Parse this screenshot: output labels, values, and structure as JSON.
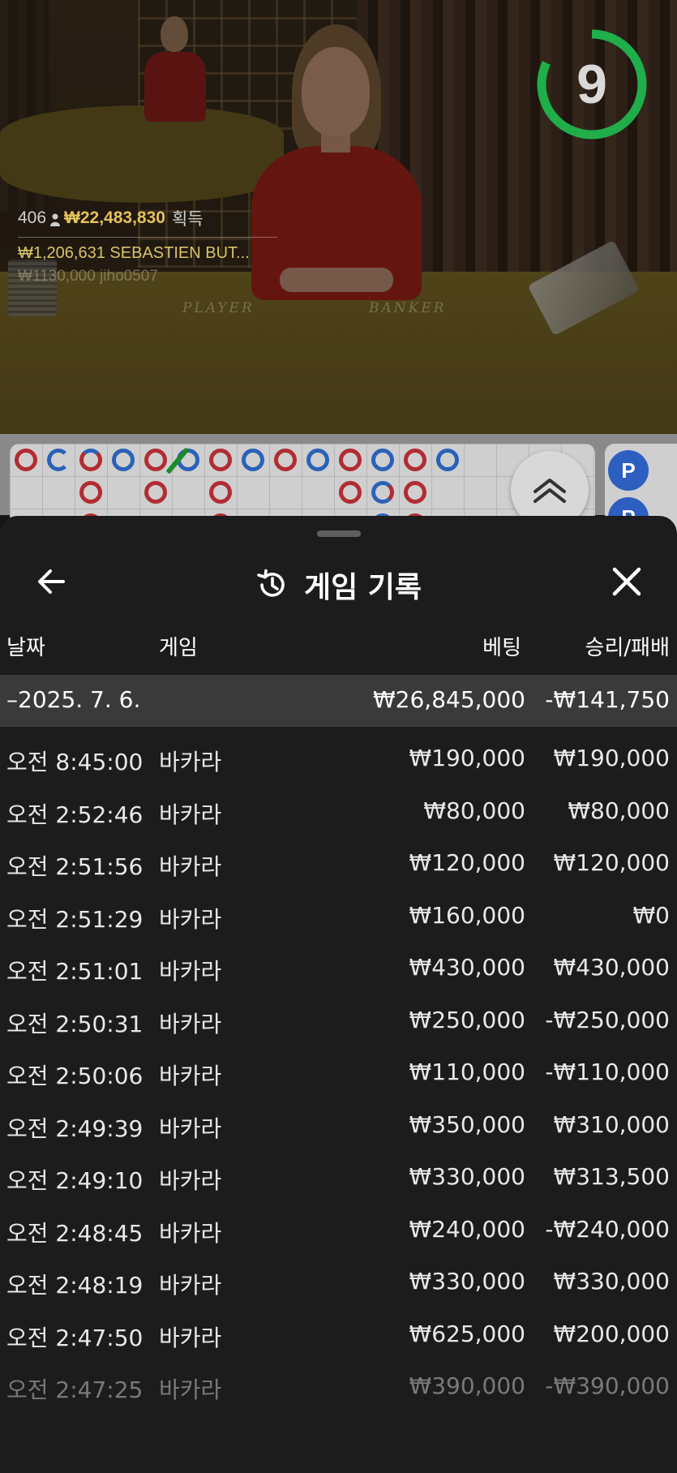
{
  "countdown": {
    "value": "9",
    "progress": 0.82,
    "color": "#1fae4a"
  },
  "winners": {
    "count": "406",
    "total": "₩22,483,830",
    "total_suffix": "획득",
    "top": [
      {
        "amount": "₩1,206,631",
        "name": "SEBASTIEN BUT..."
      },
      {
        "amount": "₩1130,000",
        "name": "jiho0507"
      }
    ]
  },
  "table_labels": {
    "player": "PLAYER",
    "banker": "BANKER"
  },
  "roadmap_side": [
    "P",
    "P"
  ],
  "history": {
    "title": "게임 기록",
    "columns": {
      "date": "날짜",
      "game": "게임",
      "bet": "베팅",
      "winloss": "승리/패배"
    },
    "day": {
      "date": "–2025. 7. 6.",
      "bet": "₩26,845,000",
      "winloss": "-₩141,750"
    },
    "rows": [
      {
        "time": "오전 8:45:00",
        "game": "바카라",
        "bet": "₩190,000",
        "winloss": "₩190,000"
      },
      {
        "time": "오전 2:52:46",
        "game": "바카라",
        "bet": "₩80,000",
        "winloss": "₩80,000"
      },
      {
        "time": "오전 2:51:56",
        "game": "바카라",
        "bet": "₩120,000",
        "winloss": "₩120,000"
      },
      {
        "time": "오전 2:51:29",
        "game": "바카라",
        "bet": "₩160,000",
        "winloss": "₩0"
      },
      {
        "time": "오전 2:51:01",
        "game": "바카라",
        "bet": "₩430,000",
        "winloss": "₩430,000"
      },
      {
        "time": "오전 2:50:31",
        "game": "바카라",
        "bet": "₩250,000",
        "winloss": "-₩250,000"
      },
      {
        "time": "오전 2:50:06",
        "game": "바카라",
        "bet": "₩110,000",
        "winloss": "-₩110,000"
      },
      {
        "time": "오전 2:49:39",
        "game": "바카라",
        "bet": "₩350,000",
        "winloss": "₩310,000"
      },
      {
        "time": "오전 2:49:10",
        "game": "바카라",
        "bet": "₩330,000",
        "winloss": "₩313,500"
      },
      {
        "time": "오전 2:48:45",
        "game": "바카라",
        "bet": "₩240,000",
        "winloss": "-₩240,000"
      },
      {
        "time": "오전 2:48:19",
        "game": "바카라",
        "bet": "₩330,000",
        "winloss": "₩330,000"
      },
      {
        "time": "오전 2:47:50",
        "game": "바카라",
        "bet": "₩625,000",
        "winloss": "₩200,000"
      },
      {
        "time": "오전 2:47:25",
        "game": "바카라",
        "bet": "₩390,000",
        "winloss": "-₩390,000"
      }
    ]
  }
}
